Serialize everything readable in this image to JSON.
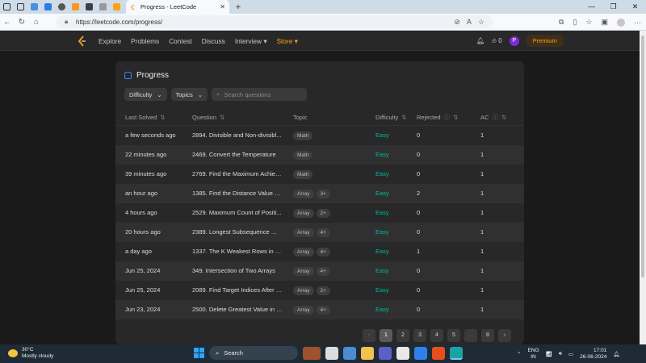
{
  "browser": {
    "tab_title": "Progress - LeetCode",
    "url": "https://leetcode.com/progress/"
  },
  "nav": {
    "items": [
      "Explore",
      "Problems",
      "Contest",
      "Discuss",
      "Interview ▾",
      "Store ▾"
    ],
    "points": "0",
    "avatar_letter": "P",
    "premium_label": "Premium"
  },
  "card": {
    "title": "Progress",
    "difficulty_label": "Difficulty",
    "topics_label": "Topics",
    "search_placeholder": "Search questions"
  },
  "table": {
    "headers": {
      "last_solved": "Last Solved",
      "question": "Question",
      "topic": "Topic",
      "difficulty": "Difficulty",
      "rejected": "Rejected",
      "ac": "AC"
    },
    "rows": [
      {
        "last": "a few seconds ago",
        "question": "2894. Divisible and Non-divisibl...",
        "topics": [
          "Math"
        ],
        "difficulty": "Easy",
        "rejected": "0",
        "ac": "1"
      },
      {
        "last": "22 minutes ago",
        "question": "2469. Convert the Temperature",
        "topics": [
          "Math"
        ],
        "difficulty": "Easy",
        "rejected": "0",
        "ac": "1"
      },
      {
        "last": "39 minutes ago",
        "question": "2769. Find the Maximum Achiev...",
        "topics": [
          "Math"
        ],
        "difficulty": "Easy",
        "rejected": "0",
        "ac": "1"
      },
      {
        "last": "an hour ago",
        "question": "1385. Find the Distance Value B...",
        "topics": [
          "Array",
          "3+"
        ],
        "difficulty": "Easy",
        "rejected": "2",
        "ac": "1"
      },
      {
        "last": "4 hours ago",
        "question": "2529. Maximum Count of Positi...",
        "topics": [
          "Array",
          "2+"
        ],
        "difficulty": "Easy",
        "rejected": "0",
        "ac": "1"
      },
      {
        "last": "20 hours ago",
        "question": "2389. Longest Subsequence Wit...",
        "topics": [
          "Array",
          "4+"
        ],
        "difficulty": "Easy",
        "rejected": "0",
        "ac": "1"
      },
      {
        "last": "a day ago",
        "question": "1337. The K Weakest Rows in a ...",
        "topics": [
          "Array",
          "4+"
        ],
        "difficulty": "Easy",
        "rejected": "1",
        "ac": "1"
      },
      {
        "last": "Jun 25, 2024",
        "question": "349. Intersection of Two Arrays",
        "topics": [
          "Array",
          "4+"
        ],
        "difficulty": "Easy",
        "rejected": "0",
        "ac": "1"
      },
      {
        "last": "Jun 25, 2024",
        "question": "2089. Find Target Indices After S...",
        "topics": [
          "Array",
          "2+"
        ],
        "difficulty": "Easy",
        "rejected": "0",
        "ac": "1"
      },
      {
        "last": "Jun 23, 2024",
        "question": "2500. Delete Greatest Value in E...",
        "topics": [
          "Array",
          "4+"
        ],
        "difficulty": "Easy",
        "rejected": "0",
        "ac": "1"
      }
    ]
  },
  "pagination": {
    "prev": "‹",
    "pages": [
      "1",
      "2",
      "3",
      "4",
      "5",
      "...",
      "8"
    ],
    "active": "1",
    "next": "›"
  },
  "taskbar": {
    "temperature": "30°C",
    "weather": "Mostly cloudy",
    "search_label": "Search",
    "lang_top": "ENG",
    "lang_bottom": "IN",
    "time": "17:01",
    "date": "26-06-2024"
  },
  "colors": {
    "accent_orange": "#ffa116",
    "easy": "#00b8a3",
    "card_bg": "#282828"
  }
}
